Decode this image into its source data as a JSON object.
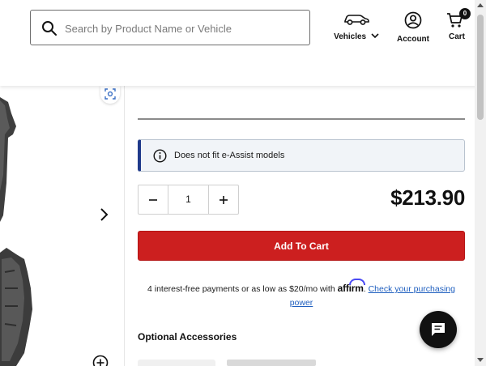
{
  "header": {
    "search_placeholder": "Search by Product Name or Vehicle",
    "vehicles_label": "Vehicles",
    "account_label": "Account",
    "cart_label": "Cart",
    "cart_count": "0"
  },
  "product": {
    "notice": "Does not fit e-Assist models",
    "quantity": "1",
    "price": "$213.90",
    "add_to_cart_label": "Add To Cart",
    "financing": {
      "text": "4 interest-free payments or as low as $20/mo with",
      "brand": "affirm",
      "separator": ".",
      "link_text": "Check your purchasing power"
    },
    "accessories_title": "Optional Accessories"
  },
  "colors": {
    "accent_red": "#cc1f1f",
    "notice_border": "#1f3a8a",
    "affirm_blue": "#4a4af4",
    "link_blue": "#1f5fbf"
  },
  "icons": [
    "search-icon",
    "car-icon",
    "chevron-down-icon",
    "account-icon",
    "cart-icon",
    "zoom-icon",
    "chevron-right-icon",
    "plus-circle-icon",
    "info-icon",
    "minus-icon",
    "plus-icon",
    "chat-icon"
  ]
}
